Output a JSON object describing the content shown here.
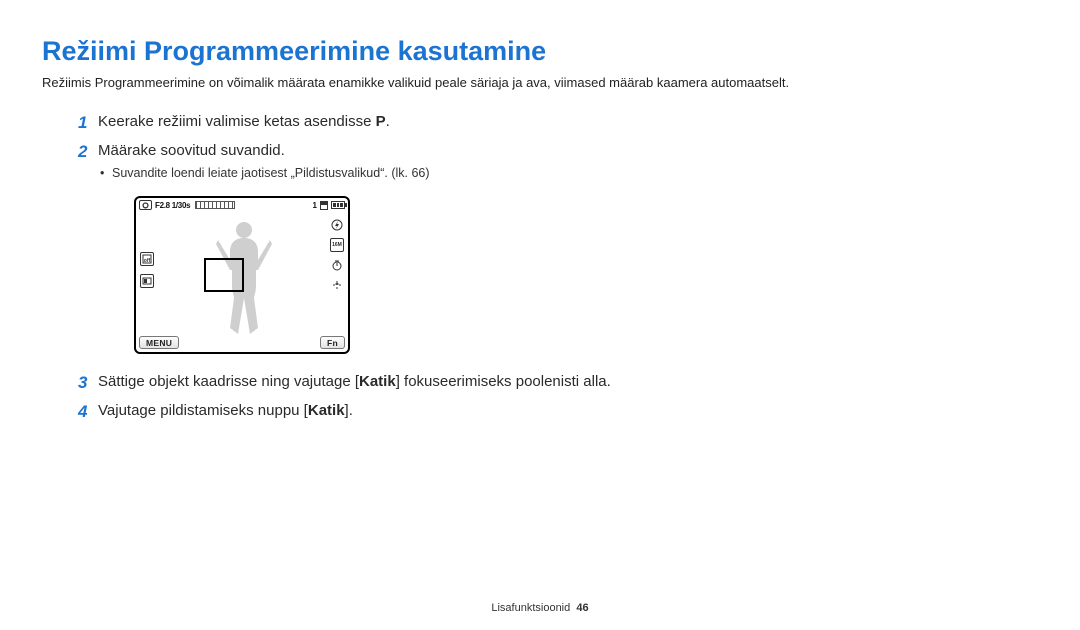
{
  "heading": "Režiimi Programmeerimine kasutamine",
  "intro": "Režiimis Programmeerimine on võimalik määrata enamikke valikuid peale säriaja ja ava, viimased määrab kaamera automaatselt.",
  "steps": {
    "1": {
      "pre": "Keerake režiimi valimise ketas asendisse ",
      "symbol": "P",
      "post": "."
    },
    "2": {
      "text": "Määrake soovitud suvandid.",
      "sub": "Suvandite loendi leiate jaotisest „Pildistusvalikud“. (lk. 66)"
    },
    "3": {
      "pre": "Sättige objekt kaadrisse ning vajutage [",
      "strong": "Katik",
      "post": "] fokuseerimiseks poolenisti alla."
    },
    "4": {
      "pre": "Vajutage pildistamiseks nuppu [",
      "strong": "Katik",
      "post": "]."
    }
  },
  "illustration": {
    "exposure_label": "F2.8 1/30s",
    "count_label": "1",
    "menu_label": "MENU",
    "fn_label": "Fn"
  },
  "footer": {
    "section": "Lisafunktsioonid",
    "page": "46"
  }
}
